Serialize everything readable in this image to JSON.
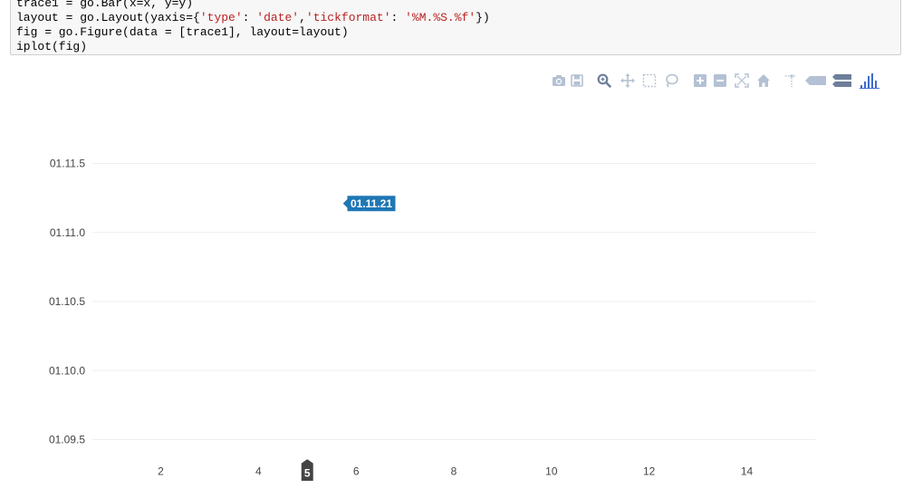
{
  "code": {
    "line0": "trace1 = go.Bar(x=x, y=y)",
    "line1_a": "layout = go.Layout(yaxis={",
    "line1_s1": "'type'",
    "line1_b": ": ",
    "line1_s2": "'date'",
    "line1_c": ",",
    "line1_s3": "'tickformat'",
    "line1_d": ": ",
    "line1_s4": "'%M.%S.%f'",
    "line1_e": "})",
    "line2": "fig = go.Figure(data = [trace1], layout=layout)",
    "line3": "iplot(fig)"
  },
  "modebar": {
    "buttons": [
      "camera-icon",
      "save-icon",
      "zoom-icon",
      "pan-icon",
      "box-select-icon",
      "lasso-select-icon",
      "zoom-in-icon",
      "zoom-out-icon",
      "autoscale-icon",
      "reset-axes-icon",
      "toggle-spike-lines-icon",
      "show-closest-icon",
      "compare-hover-icon",
      "plotly-logo-icon"
    ],
    "icon_color": "#b4c1d4",
    "logo_color": "#3f6dcc"
  },
  "chart_data": {
    "type": "bar",
    "x_ticks": [
      "2",
      "4",
      "6",
      "8",
      "10",
      "12",
      "14"
    ],
    "x_tick_values": [
      2,
      4,
      6,
      8,
      10,
      12,
      14
    ],
    "y_ticks": [
      "01.11.5",
      "01.11.0",
      "01.10.5",
      "01.10.0",
      "01.09.5"
    ],
    "y_tick_values": [
      1.5,
      1.0,
      0.5,
      0.0,
      -0.5
    ],
    "xlim": [
      0.6,
      15.4
    ],
    "ylim": [
      -0.5,
      1.5
    ],
    "hover": {
      "x": 5,
      "x_label": "5",
      "y_label": "01.11.21",
      "y": 1.21
    },
    "grid": true,
    "hover_color": "#1f77b4",
    "x_spike_color": "#444444"
  }
}
